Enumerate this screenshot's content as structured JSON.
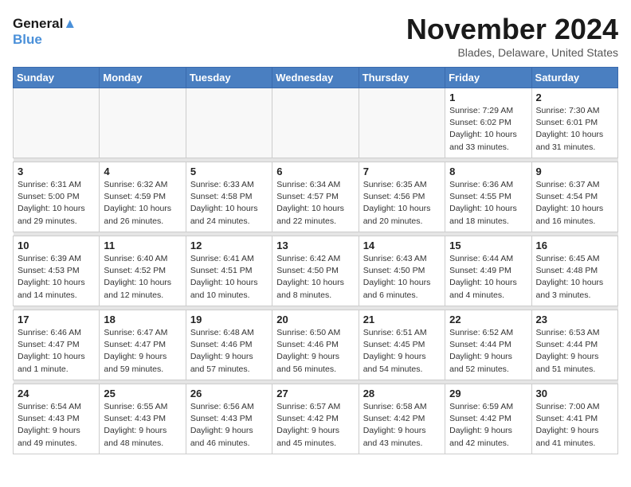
{
  "header": {
    "logo_line1": "General",
    "logo_line2": "Blue",
    "month": "November 2024",
    "location": "Blades, Delaware, United States"
  },
  "weekdays": [
    "Sunday",
    "Monday",
    "Tuesday",
    "Wednesday",
    "Thursday",
    "Friday",
    "Saturday"
  ],
  "weeks": [
    [
      {
        "day": "",
        "info": ""
      },
      {
        "day": "",
        "info": ""
      },
      {
        "day": "",
        "info": ""
      },
      {
        "day": "",
        "info": ""
      },
      {
        "day": "",
        "info": ""
      },
      {
        "day": "1",
        "info": "Sunrise: 7:29 AM\nSunset: 6:02 PM\nDaylight: 10 hours and 33 minutes."
      },
      {
        "day": "2",
        "info": "Sunrise: 7:30 AM\nSunset: 6:01 PM\nDaylight: 10 hours and 31 minutes."
      }
    ],
    [
      {
        "day": "3",
        "info": "Sunrise: 6:31 AM\nSunset: 5:00 PM\nDaylight: 10 hours and 29 minutes."
      },
      {
        "day": "4",
        "info": "Sunrise: 6:32 AM\nSunset: 4:59 PM\nDaylight: 10 hours and 26 minutes."
      },
      {
        "day": "5",
        "info": "Sunrise: 6:33 AM\nSunset: 4:58 PM\nDaylight: 10 hours and 24 minutes."
      },
      {
        "day": "6",
        "info": "Sunrise: 6:34 AM\nSunset: 4:57 PM\nDaylight: 10 hours and 22 minutes."
      },
      {
        "day": "7",
        "info": "Sunrise: 6:35 AM\nSunset: 4:56 PM\nDaylight: 10 hours and 20 minutes."
      },
      {
        "day": "8",
        "info": "Sunrise: 6:36 AM\nSunset: 4:55 PM\nDaylight: 10 hours and 18 minutes."
      },
      {
        "day": "9",
        "info": "Sunrise: 6:37 AM\nSunset: 4:54 PM\nDaylight: 10 hours and 16 minutes."
      }
    ],
    [
      {
        "day": "10",
        "info": "Sunrise: 6:39 AM\nSunset: 4:53 PM\nDaylight: 10 hours and 14 minutes."
      },
      {
        "day": "11",
        "info": "Sunrise: 6:40 AM\nSunset: 4:52 PM\nDaylight: 10 hours and 12 minutes."
      },
      {
        "day": "12",
        "info": "Sunrise: 6:41 AM\nSunset: 4:51 PM\nDaylight: 10 hours and 10 minutes."
      },
      {
        "day": "13",
        "info": "Sunrise: 6:42 AM\nSunset: 4:50 PM\nDaylight: 10 hours and 8 minutes."
      },
      {
        "day": "14",
        "info": "Sunrise: 6:43 AM\nSunset: 4:50 PM\nDaylight: 10 hours and 6 minutes."
      },
      {
        "day": "15",
        "info": "Sunrise: 6:44 AM\nSunset: 4:49 PM\nDaylight: 10 hours and 4 minutes."
      },
      {
        "day": "16",
        "info": "Sunrise: 6:45 AM\nSunset: 4:48 PM\nDaylight: 10 hours and 3 minutes."
      }
    ],
    [
      {
        "day": "17",
        "info": "Sunrise: 6:46 AM\nSunset: 4:47 PM\nDaylight: 10 hours and 1 minute."
      },
      {
        "day": "18",
        "info": "Sunrise: 6:47 AM\nSunset: 4:47 PM\nDaylight: 9 hours and 59 minutes."
      },
      {
        "day": "19",
        "info": "Sunrise: 6:48 AM\nSunset: 4:46 PM\nDaylight: 9 hours and 57 minutes."
      },
      {
        "day": "20",
        "info": "Sunrise: 6:50 AM\nSunset: 4:46 PM\nDaylight: 9 hours and 56 minutes."
      },
      {
        "day": "21",
        "info": "Sunrise: 6:51 AM\nSunset: 4:45 PM\nDaylight: 9 hours and 54 minutes."
      },
      {
        "day": "22",
        "info": "Sunrise: 6:52 AM\nSunset: 4:44 PM\nDaylight: 9 hours and 52 minutes."
      },
      {
        "day": "23",
        "info": "Sunrise: 6:53 AM\nSunset: 4:44 PM\nDaylight: 9 hours and 51 minutes."
      }
    ],
    [
      {
        "day": "24",
        "info": "Sunrise: 6:54 AM\nSunset: 4:43 PM\nDaylight: 9 hours and 49 minutes."
      },
      {
        "day": "25",
        "info": "Sunrise: 6:55 AM\nSunset: 4:43 PM\nDaylight: 9 hours and 48 minutes."
      },
      {
        "day": "26",
        "info": "Sunrise: 6:56 AM\nSunset: 4:43 PM\nDaylight: 9 hours and 46 minutes."
      },
      {
        "day": "27",
        "info": "Sunrise: 6:57 AM\nSunset: 4:42 PM\nDaylight: 9 hours and 45 minutes."
      },
      {
        "day": "28",
        "info": "Sunrise: 6:58 AM\nSunset: 4:42 PM\nDaylight: 9 hours and 43 minutes."
      },
      {
        "day": "29",
        "info": "Sunrise: 6:59 AM\nSunset: 4:42 PM\nDaylight: 9 hours and 42 minutes."
      },
      {
        "day": "30",
        "info": "Sunrise: 7:00 AM\nSunset: 4:41 PM\nDaylight: 9 hours and 41 minutes."
      }
    ]
  ]
}
